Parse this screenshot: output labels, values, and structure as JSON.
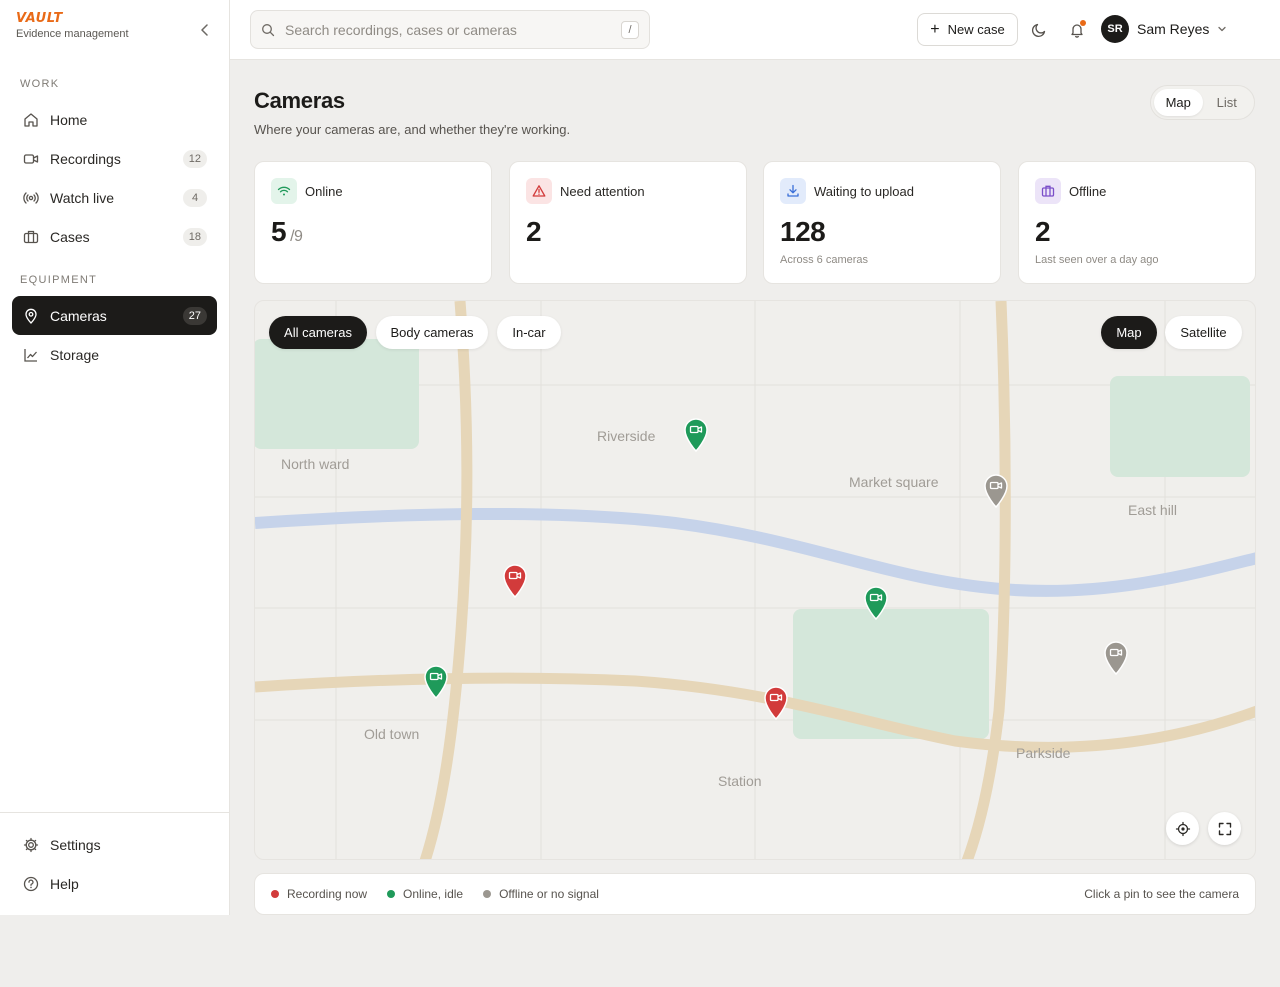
{
  "brand": {
    "logo": "VAULT",
    "subtitle": "Evidence management"
  },
  "sidebar": {
    "work_label": "WORK",
    "equipment_label": "EQUIPMENT",
    "items": [
      {
        "label": "Home",
        "icon": "home-icon"
      },
      {
        "label": "Recordings",
        "icon": "video-icon",
        "count": "12"
      },
      {
        "label": "Watch live",
        "icon": "broadcast-icon",
        "count": "4"
      },
      {
        "label": "Cases",
        "icon": "briefcase-icon",
        "count": "18"
      },
      {
        "label": "Cameras",
        "icon": "map-pin-icon",
        "count": "27",
        "active": true
      },
      {
        "label": "Storage",
        "icon": "chart-icon"
      }
    ],
    "footer": [
      {
        "label": "Settings",
        "icon": "gear-icon"
      },
      {
        "label": "Help",
        "icon": "help-icon"
      }
    ]
  },
  "topbar": {
    "search_placeholder": "Search recordings, cases or cameras",
    "search_shortcut": "/",
    "new_case": "New case",
    "user": {
      "initials": "SR",
      "name": "Sam Reyes"
    }
  },
  "page": {
    "title": "Cameras",
    "subtitle": "Where your cameras are, and whether they're working.",
    "view_toggle": {
      "options": [
        "Map",
        "List"
      ],
      "selected": "Map"
    }
  },
  "stats": [
    {
      "label": "Online",
      "value": "5",
      "of": "/9",
      "foot": "",
      "icon": "wifi-icon",
      "accent": "#1f9a5a",
      "tint": "#e3f4ea"
    },
    {
      "label": "Need attention",
      "value": "2",
      "foot": "",
      "icon": "warning-icon",
      "accent": "#d23b3b",
      "tint": "#fbe4e4"
    },
    {
      "label": "Waiting to upload",
      "value": "128",
      "foot": "Across 6 cameras",
      "icon": "download-icon",
      "accent": "#3a6fd8",
      "tint": "#e2ebfb"
    },
    {
      "label": "Offline",
      "value": "2",
      "foot": "Last seen over a day ago",
      "icon": "briefcase-icon",
      "accent": "#7b4fc9",
      "tint": "#ece4f8"
    }
  ],
  "map": {
    "filters": [
      "All cameras",
      "Body cameras",
      "In-car"
    ],
    "active_filter": "All cameras",
    "layers": [
      "Map",
      "Satellite"
    ],
    "active_layer": "Map",
    "places": [
      "Riverside",
      "North ward",
      "Market square",
      "East hill",
      "Old town",
      "Station",
      "Parkside"
    ],
    "pins": [
      {
        "status": "online"
      },
      {
        "status": "offline"
      },
      {
        "status": "recording"
      },
      {
        "status": "online"
      },
      {
        "status": "offline"
      },
      {
        "status": "online"
      },
      {
        "status": "recording"
      }
    ]
  },
  "legend": {
    "items": [
      {
        "label": "Recording now",
        "color": "#d23b3b"
      },
      {
        "label": "Online, idle",
        "color": "#1f9a5a"
      },
      {
        "label": "Offline or no signal",
        "color": "#9b9790"
      }
    ],
    "hint": "Click a pin to see the camera"
  },
  "colors": {
    "brand": "#e96a17",
    "recording": "#d23b3b",
    "online": "#1f9a5a",
    "offline": "#9b9790",
    "dark": "#1c1b19"
  }
}
